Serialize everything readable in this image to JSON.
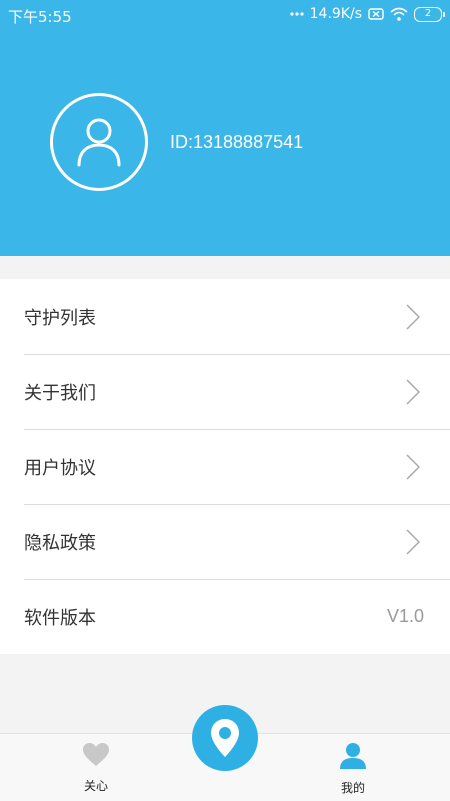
{
  "status_bar": {
    "time": "下午5:55",
    "speed": "14.9K/s",
    "battery": "2"
  },
  "header": {
    "avatar_icon": "user-icon",
    "user_id": "ID:13188887541"
  },
  "menu": {
    "items": [
      {
        "label": "守护列表"
      },
      {
        "label": "关于我们"
      },
      {
        "label": "用户协议"
      },
      {
        "label": "隐私政策"
      }
    ],
    "version_label": "软件版本",
    "version_value": "V1.0"
  },
  "tabbar": {
    "care_label": "关心",
    "mine_label": "我的",
    "active_tab": "我的"
  },
  "colors": {
    "accent": "#3bb6e8",
    "inactive_icon": "#c8c8c8"
  }
}
